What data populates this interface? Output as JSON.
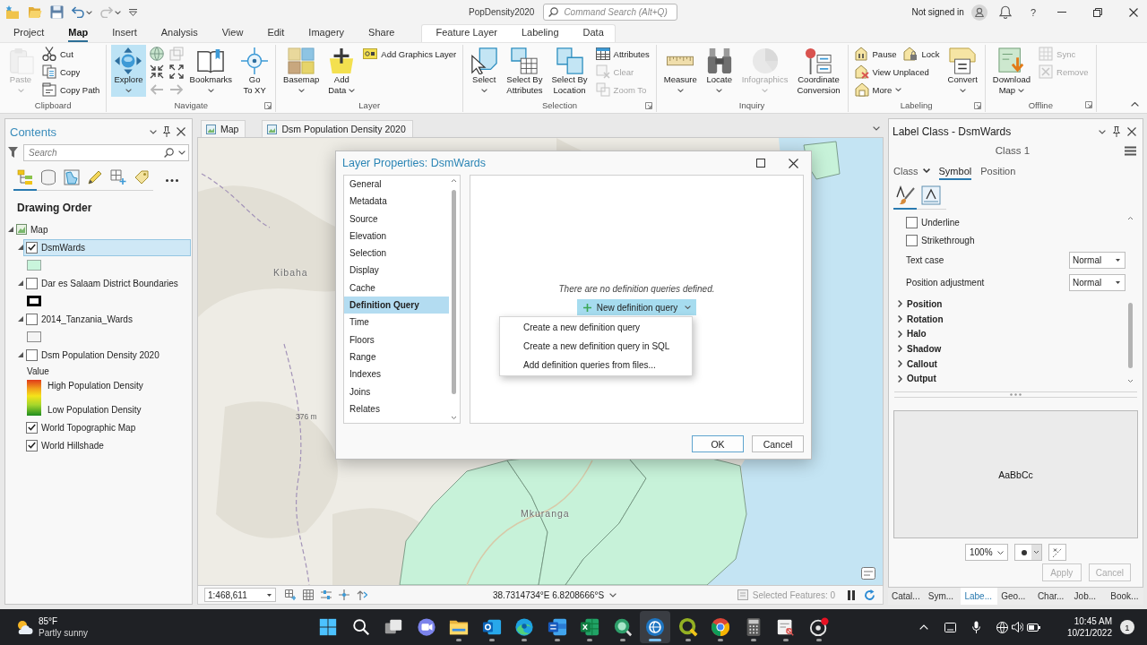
{
  "title_bar": {
    "title": "PopDensity2020",
    "search": {
      "placeholder": "Command Search (Alt+Q)"
    },
    "account": "Not signed in",
    "help": "?"
  },
  "ribbon": {
    "tabs": [
      {
        "label": "Project",
        "selected": false
      },
      {
        "label": "Map",
        "selected": true
      },
      {
        "label": "Insert",
        "selected": false
      },
      {
        "label": "Analysis",
        "selected": false
      },
      {
        "label": "View",
        "selected": false
      },
      {
        "label": "Edit",
        "selected": false
      },
      {
        "label": "Imagery",
        "selected": false
      },
      {
        "label": "Share",
        "selected": false
      }
    ],
    "contextual_tabs": [
      {
        "label": "Feature Layer",
        "selected": false
      },
      {
        "label": "Labeling",
        "selected": false
      },
      {
        "label": "Data",
        "selected": false
      }
    ],
    "groups": [
      {
        "label": "Clipboard",
        "launcher": false,
        "items": [
          {
            "kind": "large",
            "label": "Paste",
            "disabled": true,
            "dropdown": true
          },
          {
            "kind": "stack",
            "rows": [
              [
                {
                  "label": "Cut",
                  "disabled": false,
                  "dropdown": false
                }
              ],
              [
                {
                  "label": "Copy",
                  "disabled": false,
                  "dropdown": false
                }
              ],
              [
                {
                  "label": "Copy Path",
                  "disabled": false,
                  "dropdown": false
                }
              ]
            ]
          }
        ]
      },
      {
        "label": "Navigate",
        "launcher": true,
        "items": [
          {
            "kind": "large",
            "label": "Explore",
            "disabled": false,
            "dropdown": true,
            "selected": true
          },
          {
            "kind": "tools",
            "buttons": [
              {
                "disabled": false
              },
              {
                "disabled": true
              },
              {
                "disabled": false
              },
              {
                "disabled": false
              },
              {
                "disabled": true
              },
              {
                "disabled": true
              }
            ]
          },
          {
            "kind": "large",
            "label": "Bookmarks",
            "disabled": false,
            "dropdown": true,
            "selected": false
          },
          {
            "kind": "large",
            "label": "Go\nTo XY",
            "disabled": false,
            "dropdown": false,
            "selected": false
          }
        ]
      },
      {
        "label": "Layer",
        "launcher": false,
        "items": [
          {
            "kind": "large",
            "label": "Basemap",
            "disabled": false,
            "dropdown": true
          },
          {
            "kind": "large",
            "label": "Add\nData",
            "disabled": false,
            "dropdown": true
          },
          {
            "kind": "stack",
            "rows": [
              [
                {
                  "label": "Add Graphics Layer",
                  "disabled": false,
                  "dropdown": false
                }
              ]
            ]
          }
        ]
      },
      {
        "label": "Selection",
        "launcher": true,
        "items": [
          {
            "kind": "large",
            "label": "Select",
            "disabled": false,
            "dropdown": true
          },
          {
            "kind": "large",
            "label": "Select By\nAttributes",
            "disabled": false,
            "dropdown": false
          },
          {
            "kind": "large",
            "label": "Select By\nLocation",
            "disabled": false,
            "dropdown": false
          },
          {
            "kind": "stack",
            "rows": [
              [
                {
                  "label": "Attributes",
                  "disabled": false,
                  "dropdown": false
                }
              ],
              [
                {
                  "label": "Clear",
                  "disabled": true,
                  "dropdown": false
                }
              ],
              [
                {
                  "label": "Zoom To",
                  "disabled": true,
                  "dropdown": false
                }
              ]
            ]
          }
        ]
      },
      {
        "label": "Inquiry",
        "launcher": false,
        "items": [
          {
            "kind": "large",
            "label": "Measure",
            "disabled": false,
            "dropdown": true
          },
          {
            "kind": "large",
            "label": "Locate",
            "disabled": false,
            "dropdown": true
          },
          {
            "kind": "large",
            "label": "Infographics",
            "disabled": true,
            "dropdown": true
          },
          {
            "kind": "large",
            "label": "Coordinate\nConversion",
            "disabled": false,
            "dropdown": false
          }
        ]
      },
      {
        "label": "Labeling",
        "launcher": true,
        "items": [
          {
            "kind": "stack",
            "rows": [
              [
                {
                  "label": "Pause",
                  "disabled": false,
                  "dropdown": false
                },
                {
                  "label": "Lock",
                  "disabled": false,
                  "dropdown": false
                }
              ],
              [
                {
                  "label": "View Unplaced",
                  "disabled": false,
                  "dropdown": false
                }
              ],
              [
                {
                  "label": "More",
                  "disabled": false,
                  "dropdown": true
                }
              ]
            ]
          },
          {
            "kind": "large",
            "label": "Convert",
            "disabled": false,
            "dropdown": true
          }
        ]
      },
      {
        "label": "Offline",
        "launcher": true,
        "items": [
          {
            "kind": "large",
            "label": "Download\nMap",
            "disabled": false,
            "dropdown": true
          },
          {
            "kind": "stack",
            "rows": [
              [
                {
                  "label": "Sync",
                  "disabled": true,
                  "dropdown": false
                }
              ],
              [
                {
                  "label": "Remove",
                  "disabled": true,
                  "dropdown": false
                }
              ]
            ]
          }
        ]
      }
    ]
  },
  "contents": {
    "title": "Contents",
    "search": {
      "placeholder": "Search"
    },
    "views": [
      {
        "selected": true
      },
      {
        "selected": false
      },
      {
        "selected": false
      },
      {
        "selected": false
      },
      {
        "selected": false
      },
      {
        "selected": false
      }
    ],
    "heading": "Drawing Order",
    "tree": [
      {
        "kind": "map",
        "label": "Map",
        "expanded": true,
        "selected": false,
        "children": [
          {
            "kind": "layer",
            "label": "DsmWards",
            "checked": true,
            "selected": true,
            "expanded": true,
            "symbol": {
              "kind": "fill",
              "color": "#c9f5dc"
            }
          },
          {
            "kind": "layer",
            "label": "Dar es Salaam District Boundaries",
            "checked": false,
            "selected": false,
            "expanded": true,
            "symbol": {
              "kind": "bold_outline",
              "color": "#000000"
            }
          },
          {
            "kind": "layer",
            "label": "2014_Tanzania_Wards",
            "checked": false,
            "selected": false,
            "expanded": true,
            "symbol": {
              "kind": "outline",
              "color": "#8c8c8c"
            }
          },
          {
            "kind": "raster",
            "label": "Dsm Population Density 2020",
            "checked": false,
            "selected": false,
            "expanded": true,
            "legend": {
              "title": "Value",
              "high": "High Population Density",
              "low": "Low Population Density"
            }
          },
          {
            "kind": "basemap",
            "label": "World Topographic Map",
            "checked": true,
            "selected": false
          },
          {
            "kind": "basemap",
            "label": "World Hillshade",
            "checked": true,
            "selected": false
          }
        ]
      }
    ]
  },
  "map_view": {
    "tabs": [
      {
        "label": "Map"
      },
      {
        "label": "Dsm Population Density 2020"
      }
    ],
    "labels": [
      {
        "kind": "place",
        "text": "Kibaha"
      },
      {
        "kind": "elevation",
        "text": "376 m"
      },
      {
        "kind": "place",
        "text": "Mkuranga"
      }
    ],
    "status_bar": {
      "scale": "1:468,611",
      "coordinates": "38.7314734°E 6.8208666°S",
      "selected_features": "Selected Features: 0"
    }
  },
  "dialog": {
    "title": "Layer Properties: DsmWards",
    "pages": [
      {
        "label": "General",
        "selected": false
      },
      {
        "label": "Metadata",
        "selected": false
      },
      {
        "label": "Source",
        "selected": false
      },
      {
        "label": "Elevation",
        "selected": false
      },
      {
        "label": "Selection",
        "selected": false
      },
      {
        "label": "Display",
        "selected": false
      },
      {
        "label": "Cache",
        "selected": false
      },
      {
        "label": "Definition Query",
        "selected": true
      },
      {
        "label": "Time",
        "selected": false
      },
      {
        "label": "Floors",
        "selected": false
      },
      {
        "label": "Range",
        "selected": false
      },
      {
        "label": "Indexes",
        "selected": false
      },
      {
        "label": "Joins",
        "selected": false
      },
      {
        "label": "Relates",
        "selected": false
      }
    ],
    "message": "There are no definition queries defined.",
    "new_query": {
      "label": "New definition query",
      "expanded": true
    },
    "menu": [
      {
        "label": "Create a new definition query"
      },
      {
        "label": "Create a new definition query in SQL"
      },
      {
        "label": "Add definition queries from files..."
      }
    ],
    "buttons": [
      {
        "label": "OK",
        "default": true
      },
      {
        "label": "Cancel",
        "default": false
      }
    ]
  },
  "label_pane": {
    "title": "Label Class - DsmWards",
    "class_name": "Class 1",
    "tabs": [
      {
        "label": "Class",
        "selected": false,
        "dropdown": true
      },
      {
        "label": "Symbol",
        "selected": true,
        "dropdown": false
      },
      {
        "label": "Position",
        "selected": false,
        "dropdown": false
      }
    ],
    "icon_tabs": [
      {
        "selected": true
      },
      {
        "selected": false
      }
    ],
    "options": [
      {
        "kind": "checkbox",
        "label": "Underline",
        "checked": false
      },
      {
        "kind": "checkbox",
        "label": "Strikethrough",
        "checked": false
      },
      {
        "kind": "dropdown",
        "label": "Text case",
        "value": "Normal"
      },
      {
        "kind": "dropdown",
        "label": "Position adjustment",
        "value": "Normal"
      },
      {
        "kind": "section",
        "label": "Position",
        "expanded": false
      },
      {
        "kind": "section",
        "label": "Rotation",
        "expanded": false
      },
      {
        "kind": "section",
        "label": "Halo",
        "expanded": false
      },
      {
        "kind": "section",
        "label": "Shadow",
        "expanded": false
      },
      {
        "kind": "section",
        "label": "Callout",
        "expanded": false
      },
      {
        "kind": "section",
        "label": "Output",
        "expanded": false
      }
    ],
    "preview": {
      "text": "AaBbCc",
      "zoom": "100%"
    },
    "buttons": [
      {
        "label": "Apply",
        "disabled": true
      },
      {
        "label": "Cancel",
        "disabled": true
      }
    ],
    "dock_tabs": [
      {
        "label": "Catal...",
        "selected": false
      },
      {
        "label": "Sym...",
        "selected": false
      },
      {
        "label": "Labe...",
        "selected": true
      },
      {
        "label": "Geo...",
        "selected": false
      },
      {
        "label": "Char...",
        "selected": false
      },
      {
        "label": "Job...",
        "selected": false
      },
      {
        "label": "Book...",
        "selected": false
      }
    ]
  },
  "taskbar": {
    "weather": {
      "temperature": "85°F",
      "condition": "Partly sunny"
    },
    "apps": [
      {
        "running": false,
        "active": false
      },
      {
        "running": false,
        "active": false
      },
      {
        "running": false,
        "active": false
      },
      {
        "running": false,
        "active": false
      },
      {
        "running": true,
        "active": false
      },
      {
        "running": true,
        "active": false
      },
      {
        "running": true,
        "active": false
      },
      {
        "running": true,
        "active": false
      },
      {
        "running": true,
        "active": false
      },
      {
        "running": true,
        "active": false
      },
      {
        "running": true,
        "active": true
      },
      {
        "running": true,
        "active": false
      },
      {
        "running": true,
        "active": false
      },
      {
        "running": true,
        "active": false
      },
      {
        "running": true,
        "active": false
      },
      {
        "running": true,
        "active": false
      }
    ],
    "clock": {
      "time": "10:45 AM",
      "date": "10/21/2022"
    },
    "notifications": "1"
  }
}
